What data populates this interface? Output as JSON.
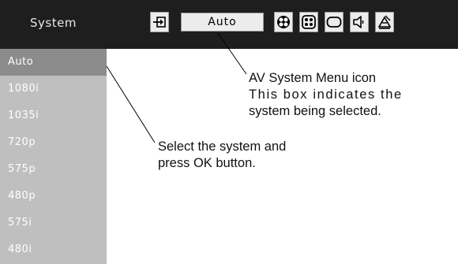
{
  "menu": {
    "title": "System",
    "current_system": "Auto"
  },
  "toolbar_icons": [
    "input-icon",
    "av-system-icon",
    "image-select-icon",
    "image-adjust-icon",
    "screen-icon",
    "sound-icon",
    "setting-icon"
  ],
  "system_list": [
    {
      "label": "Auto",
      "selected": true
    },
    {
      "label": "1080i",
      "selected": false
    },
    {
      "label": "1035i",
      "selected": false
    },
    {
      "label": "720p",
      "selected": false
    },
    {
      "label": "575p",
      "selected": false
    },
    {
      "label": "480p",
      "selected": false
    },
    {
      "label": "575i",
      "selected": false
    },
    {
      "label": "480i",
      "selected": false
    }
  ],
  "annotations": {
    "icon_callout": {
      "title": "AV System Menu",
      "title_suffix": " icon",
      "line2": "This box indicates the",
      "line3": "system being selected."
    },
    "list_callout": {
      "line1": "Select the system and",
      "line2_prefix": "press ",
      "line2_bold": "OK",
      "line2_suffix": " button."
    }
  },
  "colors": {
    "menubar_bg": "#1e1e1e",
    "list_bg": "#bfbfbf",
    "selected_bg": "#8c8c8c"
  }
}
